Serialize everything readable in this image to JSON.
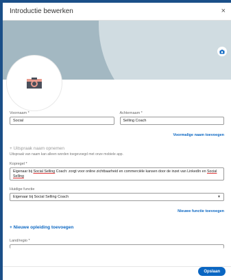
{
  "dialog": {
    "title": "Introductie bewerken",
    "close_glyph": "×"
  },
  "banner": {
    "camera_icon": "camera-icon"
  },
  "fields": {
    "first_name": {
      "label": "Voornaam *",
      "value": "Social"
    },
    "last_name": {
      "label": "Achternaam *",
      "value": "Selling Coach"
    },
    "former_name_link": "Voormalige naam toevoegen",
    "pronunciation_title": "+ Uitspraak naam opnemen",
    "pronunciation_note": "Uitspraak van naam kan alleen worden toegevoegd met onze mobiele app.",
    "headline": {
      "label": "Kopregel *",
      "value_part1": "Eigenaar bij ",
      "value_link1": "Social Selling",
      "value_part2": " Coach: zorgt voor online zichtbaarheid en commerciële kansen door de inzet van LinkedIn en ",
      "value_link2": "Social Selling"
    },
    "current_position": {
      "label": "Huidige functie",
      "value": "Eigenaar bij Social Selling Coach"
    },
    "new_position_link": "Nieuwe functie toevoegen",
    "new_education_link": "+ Nieuwe opleiding toevoegen",
    "country": {
      "label": "Land/regio *",
      "value": ""
    }
  },
  "footer": {
    "save_label": "Opslaan"
  },
  "colors": {
    "accent": "#0a66c2",
    "backdrop": "#1b4f88"
  }
}
